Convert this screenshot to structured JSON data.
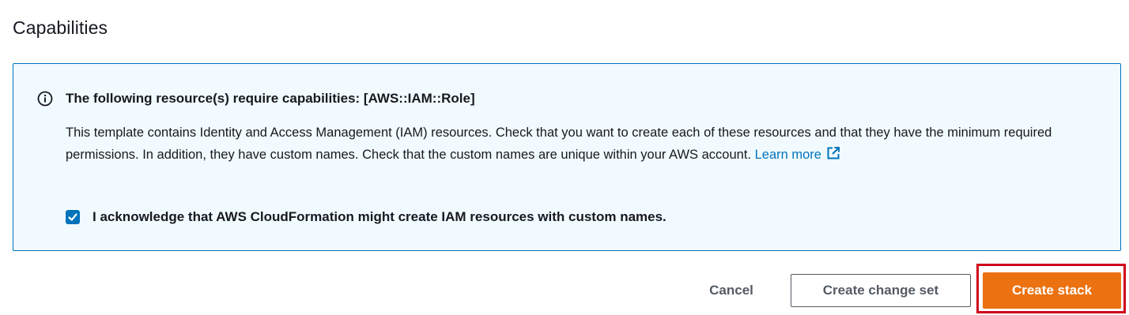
{
  "section": {
    "title": "Capabilities"
  },
  "alert": {
    "type": "info",
    "icon": "info-circle-icon",
    "heading": "The following resource(s) require capabilities: [AWS::IAM::Role]",
    "body": "This template contains Identity and Access Management (IAM) resources. Check that you want to create each of these resources and that they have the minimum required permissions. In addition, they have custom names. Check that the custom names are unique within your AWS account.",
    "learn_more": "Learn more",
    "learn_more_icon": "external-link-icon",
    "acknowledge": {
      "checked": true,
      "label": "I acknowledge that AWS CloudFormation might create IAM resources with custom names."
    }
  },
  "actions": {
    "cancel": "Cancel",
    "create_change_set": "Create change set",
    "create_stack": "Create stack"
  },
  "colors": {
    "accent_blue": "#0073bb",
    "alert_background": "#f1faff",
    "primary_orange": "#ec7211",
    "highlight_red": "#d0021b"
  }
}
